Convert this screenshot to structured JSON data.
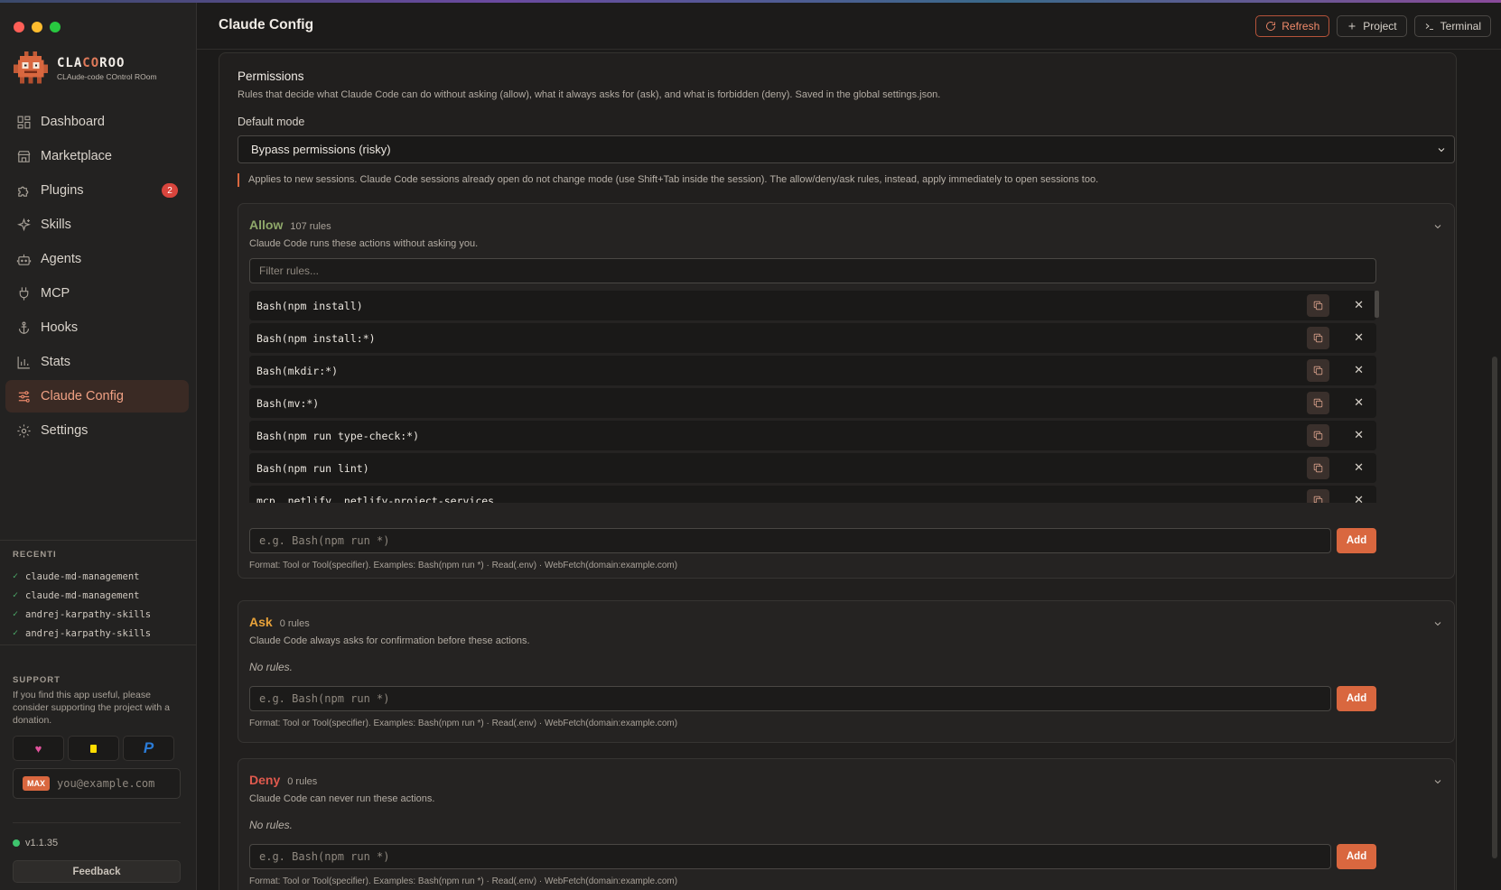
{
  "app": {
    "brand_name_a": "CLA",
    "brand_name_b": "CO",
    "brand_name_c": "ROO",
    "brand_subtitle": "CLAude-code COntrol ROom"
  },
  "sidebar": {
    "items": [
      {
        "label": "Dashboard",
        "icon": "dashboard-icon"
      },
      {
        "label": "Marketplace",
        "icon": "store-icon"
      },
      {
        "label": "Plugins",
        "icon": "puzzle-icon",
        "badge": "2"
      },
      {
        "label": "Skills",
        "icon": "sparkle-icon"
      },
      {
        "label": "Agents",
        "icon": "bot-icon"
      },
      {
        "label": "MCP",
        "icon": "plug-icon"
      },
      {
        "label": "Hooks",
        "icon": "anchor-icon"
      },
      {
        "label": "Stats",
        "icon": "bar-chart-icon"
      },
      {
        "label": "Claude Config",
        "icon": "sliders-icon",
        "active": true
      },
      {
        "label": "Settings",
        "icon": "gear-icon"
      }
    ],
    "recent_title": "RECENTI",
    "recent": [
      "claude-md-management",
      "claude-md-management",
      "andrej-karpathy-skills",
      "andrej-karpathy-skills"
    ],
    "support_title": "SUPPORT",
    "support_text": "If you find this app useful, please consider supporting the project with a donation.",
    "max_label": "MAX",
    "email_placeholder": "you@example.com",
    "version": "v1.1.35",
    "feedback": "Feedback"
  },
  "header": {
    "title": "Claude Config",
    "refresh": "Refresh",
    "project": "Project",
    "terminal": "Terminal"
  },
  "permissions": {
    "title": "Permissions",
    "description": "Rules that decide what Claude Code can do without asking (allow), what it always asks for (ask), and what is forbidden (deny). Saved in the global settings.json.",
    "default_mode_label": "Default mode",
    "default_mode_value": "Bypass permissions (risky)",
    "note": "Applies to new sessions. Claude Code sessions already open do not change mode (use Shift+Tab inside the session). The allow/deny/ask rules, instead, apply immediately to open sessions too.",
    "allow": {
      "name": "Allow",
      "count": "107 rules",
      "description": "Claude Code runs these actions without asking you.",
      "filter_placeholder": "Filter rules...",
      "rules": [
        "Bash(npm install)",
        "Bash(npm install:*)",
        "Bash(mkdir:*)",
        "Bash(mv:*)",
        "Bash(npm run type-check:*)",
        "Bash(npm run lint)",
        "mcp__netlify__netlify-project-services"
      ]
    },
    "ask": {
      "name": "Ask",
      "count": "0 rules",
      "description": "Claude Code always asks for confirmation before these actions.",
      "empty": "No rules."
    },
    "deny": {
      "name": "Deny",
      "count": "0 rules",
      "description": "Claude Code can never run these actions.",
      "empty": "No rules."
    },
    "add_placeholder": "e.g. Bash(npm run *)",
    "add_label": "Add",
    "format_hint": "Format: Tool or Tool(specifier). Examples: Bash(npm run *) · Read(.env) · WebFetch(domain:example.com)"
  },
  "colors": {
    "accent": "#d9673f",
    "allow": "#8fa86a",
    "ask": "#e8a23a",
    "deny": "#e05a4e"
  }
}
